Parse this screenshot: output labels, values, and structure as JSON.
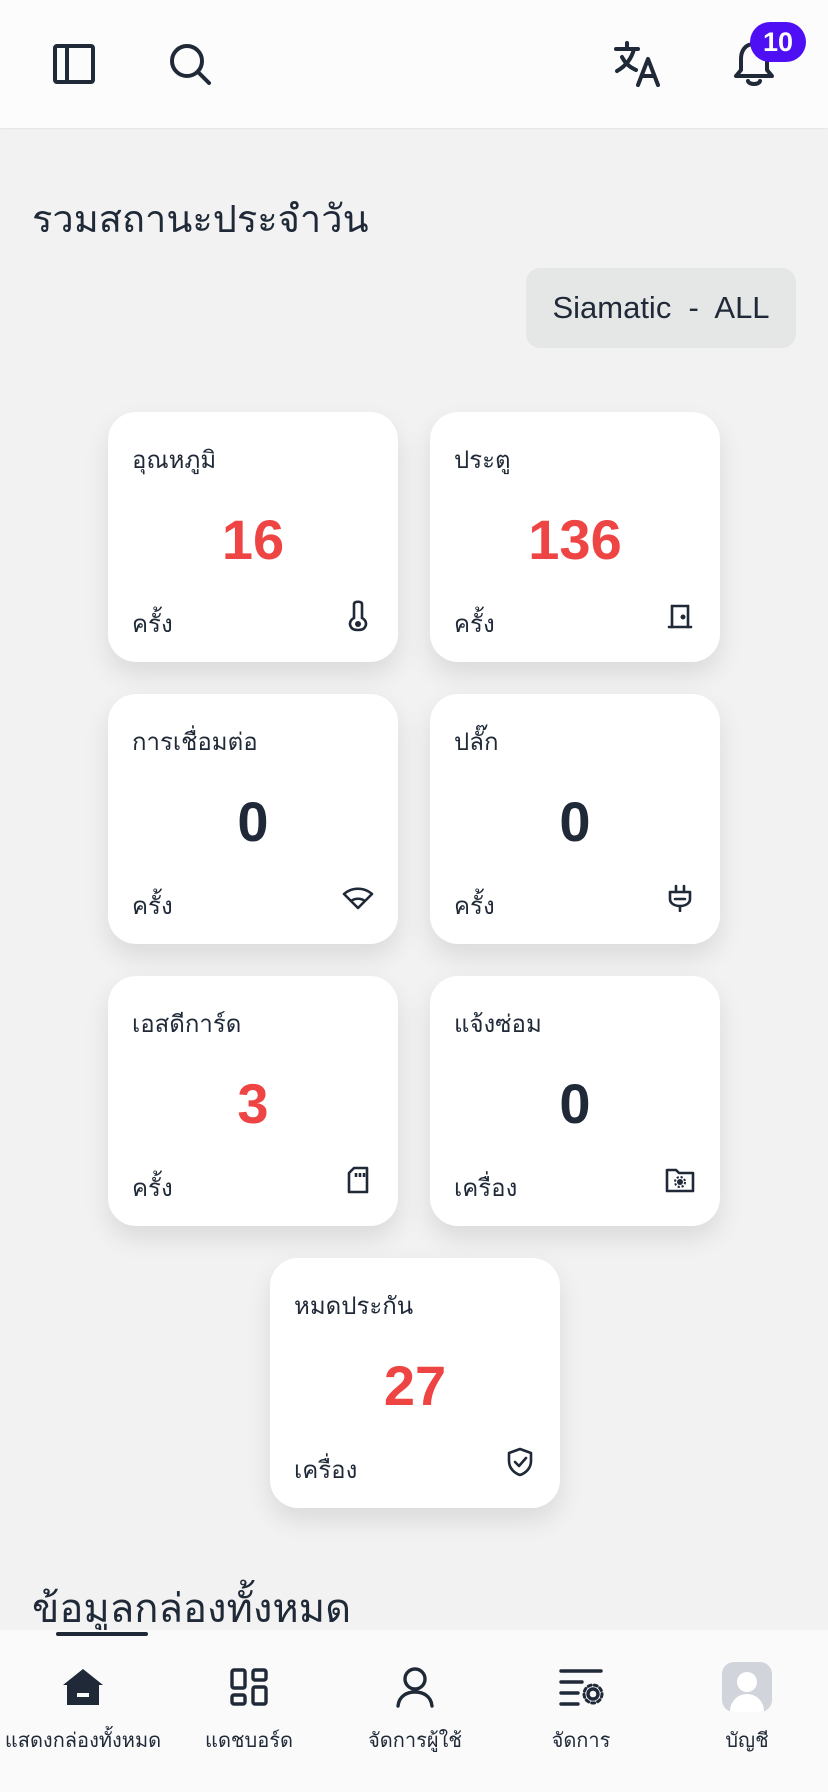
{
  "header": {
    "notification_count": "10"
  },
  "page": {
    "title": "รวมสถานะประจำวัน",
    "site_selector": "Siamatic  -  ALL"
  },
  "colors": {
    "alert_value": "#ef4444",
    "normal_value": "#1f2937",
    "badge": "#4f0ff5"
  },
  "cards": [
    {
      "title": "อุณหภูมิ",
      "value": "16",
      "unit": "ครั้ง",
      "icon": "thermometer-icon",
      "alert": true
    },
    {
      "title": "ประตู",
      "value": "136",
      "unit": "ครั้ง",
      "icon": "door-icon",
      "alert": true
    },
    {
      "title": "การเชื่อมต่อ",
      "value": "0",
      "unit": "ครั้ง",
      "icon": "wifi-icon",
      "alert": false
    },
    {
      "title": "ปลั๊ก",
      "value": "0",
      "unit": "ครั้ง",
      "icon": "plug-icon",
      "alert": false
    },
    {
      "title": "เอสดีการ์ด",
      "value": "3",
      "unit": "ครั้ง",
      "icon": "sd-card-icon",
      "alert": true
    },
    {
      "title": "แจ้งซ่อม",
      "value": "0",
      "unit": "เครื่อง",
      "icon": "folder-gear-icon",
      "alert": false
    },
    {
      "title": "หมดประกัน",
      "value": "27",
      "unit": "เครื่อง",
      "icon": "shield-check-icon",
      "alert": true
    }
  ],
  "section": {
    "title": "ข้อมูลกล่องทั้งหมด"
  },
  "bottom_nav": [
    {
      "label": "แสดงกล่องทั้งหมด",
      "icon": "home-icon",
      "active": true
    },
    {
      "label": "แดชบอร์ด",
      "icon": "dashboard-icon",
      "active": false
    },
    {
      "label": "จัดการผู้ใช้",
      "icon": "user-icon",
      "active": false
    },
    {
      "label": "จัดการ",
      "icon": "manage-settings-icon",
      "active": false
    },
    {
      "label": "บัญชี",
      "icon": "avatar-icon",
      "active": false
    }
  ]
}
